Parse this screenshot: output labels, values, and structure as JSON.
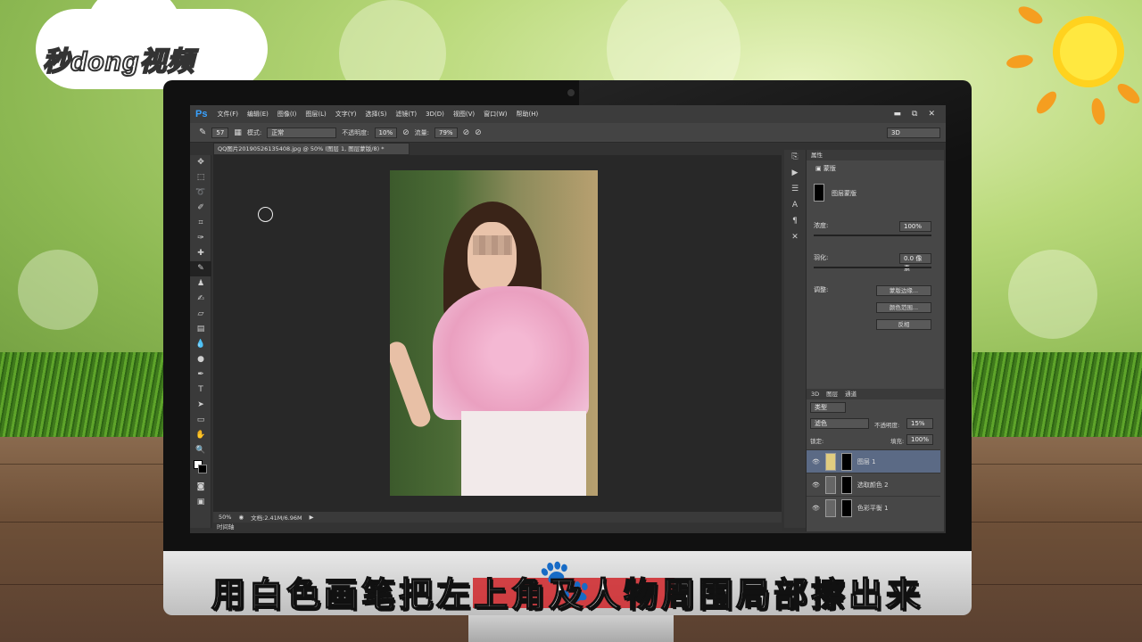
{
  "watermark": {
    "logo_text": "秒dong视频"
  },
  "photoshop": {
    "app_logo": "Ps",
    "menu": [
      "文件(F)",
      "编辑(E)",
      "图像(I)",
      "图层(L)",
      "文字(Y)",
      "选择(S)",
      "滤镜(T)",
      "3D(D)",
      "视图(V)",
      "窗口(W)",
      "帮助(H)"
    ],
    "window_buttons": [
      "▬",
      "⧉",
      "✕"
    ],
    "options": {
      "brush_size": "57",
      "mode_label": "模式:",
      "mode_value": "正常",
      "opacity_label": "不透明度:",
      "opacity_value": "10%",
      "flow_label": "流量:",
      "flow_value": "79%",
      "workspace": "3D"
    },
    "document_tab": "QQ图片20190526135408.jpg @ 50% (图层 1, 图层蒙版/8) *",
    "status": {
      "zoom": "50%",
      "doc_size": "文档:2.41M/6.96M",
      "timeline": "时间轴"
    },
    "properties": {
      "tab": "属性",
      "section": "蒙版",
      "mask_label": "图层蒙版",
      "density_label": "浓度:",
      "density_value": "100%",
      "feather_label": "羽化:",
      "feather_value": "0.0 像素",
      "adjust_label": "调整:",
      "buttons": [
        "蒙版边缘...",
        "颜色范围...",
        "反相"
      ]
    },
    "layers_panel": {
      "tabs": [
        "3D",
        "图层",
        "通道"
      ],
      "filter": "类型",
      "blend_mode": "滤色",
      "opacity_label": "不透明度:",
      "opacity_value": "15%",
      "lock_label": "锁定:",
      "fill_label": "填充:",
      "fill_value": "100%",
      "layers": [
        {
          "name": "图层 1",
          "selected": true
        },
        {
          "name": "选取颜色 2",
          "selected": false
        },
        {
          "name": "色彩平衡 1",
          "selected": false
        }
      ]
    }
  },
  "subtitle": "用白色画笔把左上角及人物周围局部擦出来"
}
